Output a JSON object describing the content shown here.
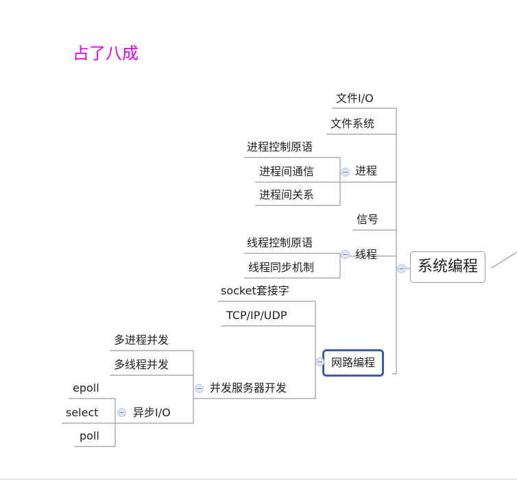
{
  "annotation": "占了八成",
  "nodes": {
    "root": "系统编程",
    "file_io": "文件I/O",
    "file_system": "文件系统",
    "process": "进程",
    "process_control": "进程控制原语",
    "process_ipc": "进程间通信",
    "process_relation": "进程间关系",
    "signal": "信号",
    "thread": "线程",
    "thread_control": "线程控制原语",
    "thread_sync": "线程同步机制",
    "network": "网路编程",
    "socket": "socket套接字",
    "tcpip": "TCP/IP/UDP",
    "concurrent_server": "并发服务器开发",
    "multi_process": "多进程并发",
    "multi_thread": "多线程并发",
    "async_io": "异步I/O",
    "epoll": "epoll",
    "select": "select",
    "poll": "poll"
  },
  "colors": {
    "annotation": "#e100e6",
    "highlight_border": "#3a5fa8",
    "line": "#9a9a9a"
  }
}
